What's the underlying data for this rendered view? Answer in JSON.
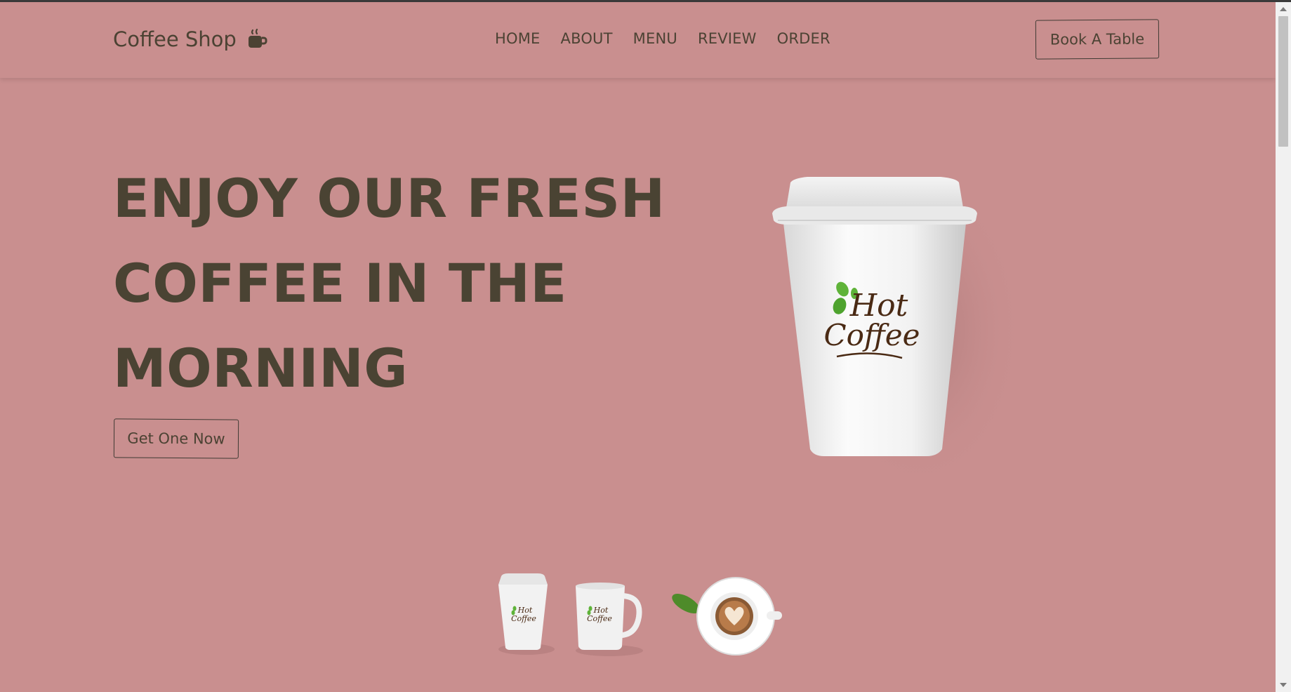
{
  "header": {
    "logo_text": "Coffee Shop",
    "logo_icon": "coffee-mug-icon",
    "nav": [
      "HOME",
      "ABOUT",
      "MENU",
      "REVIEW",
      "ORDER"
    ],
    "book_button": "Book A Table"
  },
  "hero": {
    "title_lines": [
      "ENJOY OUR FRESH",
      "COFFEE IN THE",
      "MORNING"
    ],
    "cta_button": "Get One Now",
    "cup_logo_line1": "Hot",
    "cup_logo_line2": "Coffee"
  },
  "thumbnails": [
    {
      "icon": "paper-cup-icon"
    },
    {
      "icon": "coffee-mug-icon"
    },
    {
      "icon": "latte-cup-icon"
    }
  ],
  "colors": {
    "background": "#c98f8f",
    "text": "#4a4333",
    "logo_brown": "#4a2a14",
    "leaf_green": "#5fb339"
  }
}
